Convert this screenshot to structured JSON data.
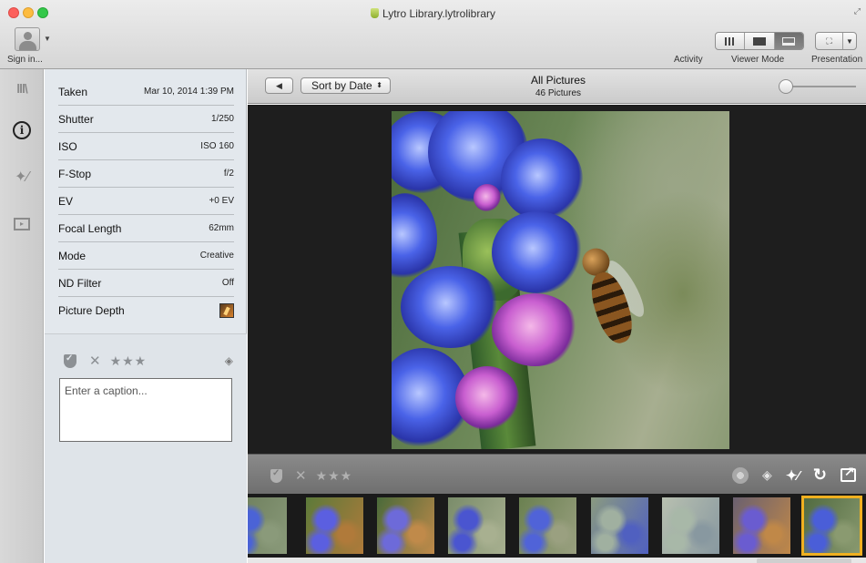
{
  "window": {
    "title": "Lytro Library.lytrolibrary",
    "app_icon": "lytro-icon"
  },
  "toolbar": {
    "sign_in_label": "Sign in...",
    "activity_label": "Activity",
    "viewer_mode_label": "Viewer Mode",
    "viewer_mode_selected": "filmstrip",
    "presentation_label": "Presentation"
  },
  "rail": {
    "items": [
      {
        "name": "library",
        "icon": "library-icon",
        "glyph": "lll\\"
      },
      {
        "name": "info",
        "icon": "info-icon",
        "glyph": "i",
        "active": true
      },
      {
        "name": "edit",
        "icon": "magic-wand-icon",
        "glyph": "✦⁄"
      },
      {
        "name": "present",
        "icon": "presentation-icon",
        "glyph": "▸"
      }
    ]
  },
  "info": {
    "rows": [
      {
        "key": "Taken",
        "value": "Mar 10, 2014 1:39 PM"
      },
      {
        "key": "Shutter",
        "value": "1/250"
      },
      {
        "key": "ISO",
        "value": "ISO 160"
      },
      {
        "key": "F-Stop",
        "value": "f/2"
      },
      {
        "key": "EV",
        "value": "+0 EV"
      },
      {
        "key": "Focal Length",
        "value": "62mm"
      },
      {
        "key": "Mode",
        "value": "Creative"
      },
      {
        "key": "ND Filter",
        "value": "Off"
      }
    ],
    "depth_label": "Picture Depth",
    "rating": {
      "stars": "★★★",
      "reject": "✕"
    },
    "caption_placeholder": "Enter a caption...",
    "caption_value": ""
  },
  "viewer": {
    "back_glyph": "◀",
    "sort_label": "Sort by Date",
    "sort_glyph": "⬍",
    "album_title": "All Pictures",
    "album_count": "46 Pictures",
    "zoom_level": 0
  },
  "actionbar": {
    "reject": "✕",
    "stars": "★★★",
    "layers_glyph": "◈",
    "magic_glyph": "✦⁄",
    "rotate_glyph": "↻"
  },
  "filmstrip": {
    "thumbnails": [
      {
        "palette": [
          "#6b7c5a",
          "#4b63d6",
          "#8a9a7a"
        ]
      },
      {
        "palette": [
          "#5c7a3a",
          "#5b5fe0",
          "#b07a3a"
        ]
      },
      {
        "palette": [
          "#4a6a3a",
          "#6d6ad9",
          "#c08a4a"
        ]
      },
      {
        "palette": [
          "#7a8c6a",
          "#4a55d0",
          "#a8b090"
        ]
      },
      {
        "palette": [
          "#6a8050",
          "#5063d8",
          "#9aa080"
        ]
      },
      {
        "palette": [
          "#8a9a80",
          "#a0b0a0",
          "#5060c0"
        ]
      },
      {
        "palette": [
          "#b8c0b0",
          "#a8b8a8",
          "#8898a0"
        ]
      },
      {
        "palette": [
          "#6a6070",
          "#6a5cd0",
          "#c08848"
        ]
      },
      {
        "palette": [
          "#506a40",
          "#4a5ed8",
          "#8a9a70"
        ],
        "selected": true
      }
    ]
  }
}
